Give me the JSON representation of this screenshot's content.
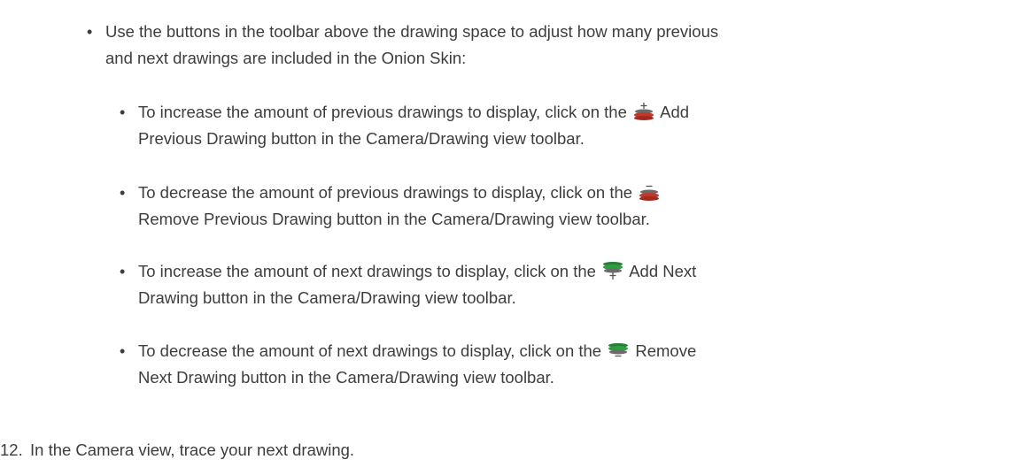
{
  "bullet_main": {
    "line1": "Use the buttons in the toolbar above the drawing space to adjust how many previous",
    "line2": "and next drawings are included in the Onion Skin:"
  },
  "sub_bullets": [
    {
      "pre": "To increase the amount of previous drawings to display, click on the",
      "icon": "add-previous-drawing-icon",
      "post_line1": " Add",
      "line2": "Previous Drawing button in the Camera/Drawing view toolbar."
    },
    {
      "pre": "To decrease the amount of previous drawings to display, click on the",
      "icon": "remove-previous-drawing-icon",
      "post_line1": "",
      "line2": "Remove Previous Drawing button in the Camera/Drawing view toolbar."
    },
    {
      "pre": "To increase the amount of next drawings to display, click on the",
      "icon": "add-next-drawing-icon",
      "post_line1": " Add Next",
      "line2": "Drawing button in the Camera/Drawing view toolbar."
    },
    {
      "pre": "To decrease the amount of next drawings to display, click on the",
      "icon": "remove-next-drawing-icon",
      "post_line1": " Remove",
      "line2": "Next Drawing button in the Camera/Drawing view toolbar."
    }
  ],
  "step": {
    "number": "12.",
    "text": "In the Camera view, trace your next drawing."
  },
  "colors": {
    "text": "#3d3d3d",
    "previous_red": "#c0392b",
    "next_green": "#2e9e3e"
  }
}
